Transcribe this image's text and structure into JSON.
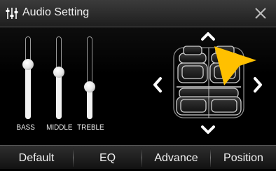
{
  "header": {
    "title": "Audio Setting",
    "title_icon": "equalizer-icon",
    "close_icon": "close-icon"
  },
  "sliders": [
    {
      "label": "BASS",
      "level_fraction": 0.66
    },
    {
      "label": "MIDDLE",
      "level_fraction": 0.57
    },
    {
      "label": "TREBLE",
      "level_fraction": 0.39
    }
  ],
  "seat_balance": {
    "up_icon": "chevron-up-icon",
    "down_icon": "chevron-down-icon",
    "left_icon": "chevron-left-icon",
    "right_icon": "chevron-right-icon",
    "indicator_color": "#ffc000"
  },
  "tabs": [
    {
      "label": "Default"
    },
    {
      "label": "EQ"
    },
    {
      "label": "Advance"
    },
    {
      "label": "Position"
    }
  ],
  "colors": {
    "accent": "#ffc000",
    "background": "#000000",
    "bar": "#2a2a2a"
  }
}
